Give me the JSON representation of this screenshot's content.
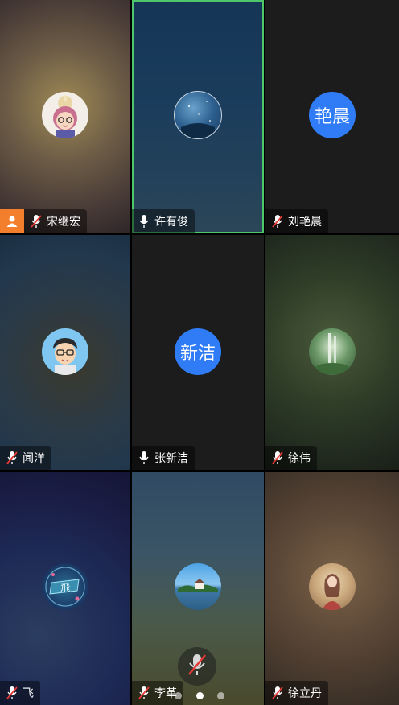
{
  "participants": [
    {
      "name": "宋继宏",
      "mic": "muted",
      "host": true,
      "avatar": "cartoon-girl"
    },
    {
      "name": "许有俊",
      "mic": "on",
      "host": false,
      "avatar": "night-sky",
      "active_speaker": true
    },
    {
      "name": "刘艳晨",
      "mic": "muted",
      "host": false,
      "avatar_text": "艳晨"
    },
    {
      "name": "闻洋",
      "mic": "muted",
      "host": false,
      "avatar": "cartoon-boy-glasses"
    },
    {
      "name": "张新洁",
      "mic": "on",
      "host": false,
      "avatar_text": "新洁"
    },
    {
      "name": "徐伟",
      "mic": "muted",
      "host": false,
      "avatar": "waterfall"
    },
    {
      "name": "飞",
      "mic": "muted",
      "host": false,
      "avatar": "fei-badge",
      "avatar_glyph": "飛"
    },
    {
      "name": "李革",
      "mic": "muted",
      "host": false,
      "avatar": "lake-house"
    },
    {
      "name": "徐立丹",
      "mic": "muted",
      "host": false,
      "avatar": "woman-photo"
    }
  ],
  "colors": {
    "accent": "#2f7cf6",
    "active_border": "#4ec76b",
    "host_badge": "#f37f2d",
    "muted_slash": "#e53935"
  },
  "pager": {
    "pages": 3,
    "current": 2
  },
  "controls": {
    "mute_icon": "mic-muted-icon"
  }
}
